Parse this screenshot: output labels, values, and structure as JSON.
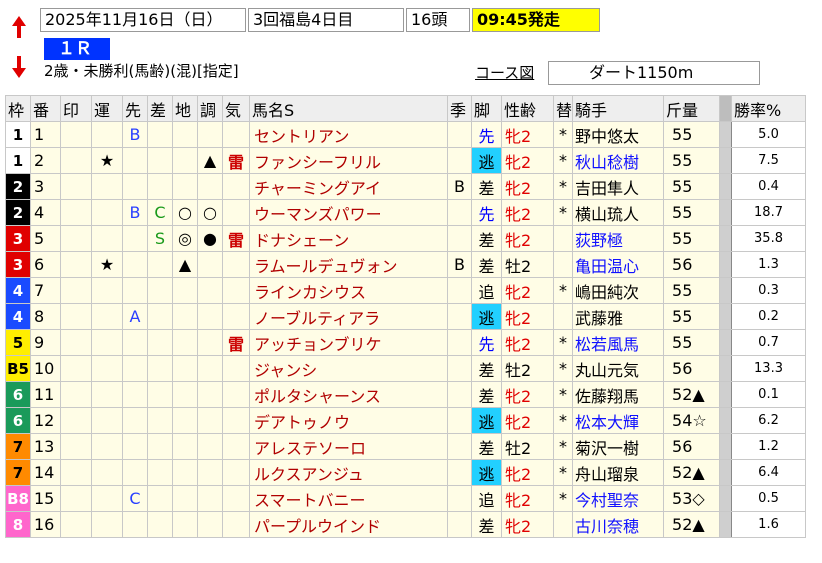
{
  "header": {
    "date": "2025年11月16日（日）",
    "meeting": "3回福島4日目",
    "count": "16頭",
    "start_time": "09:45発走",
    "race_number": "１Ｒ",
    "condition": "2歳・未勝利(馬齢)(混)[指定]",
    "course_label": "コース図",
    "course": "ダート1150m"
  },
  "columns": [
    "枠",
    "番",
    "印",
    "運",
    "先",
    "差",
    "地",
    "調",
    "気",
    "馬名S",
    "季",
    "脚",
    "性齢",
    "替",
    "騎手",
    "斤量",
    "",
    "勝率%"
  ],
  "rows": [
    {
      "waku": "1",
      "wcls": "w1",
      "num": "1",
      "mark": "",
      "un": "",
      "saki": "B",
      "sa": "",
      "chi": "",
      "cho": "",
      "ki": "",
      "name": "セントリアン",
      "season": "",
      "leg": "先",
      "sex": "牝2",
      "kae": "*",
      "jockey": "野中悠太",
      "jblue": false,
      "weight": "55",
      "rate": "5.0"
    },
    {
      "waku": "1",
      "wcls": "w1",
      "num": "2",
      "mark": "",
      "un": "★",
      "saki": "",
      "sa": "",
      "chi": "",
      "cho": "▲",
      "ki": "雷",
      "name": "ファンシーフリル",
      "season": "",
      "leg": "逃",
      "sex": "牝2",
      "kae": "*",
      "jockey": "秋山稔樹",
      "jblue": true,
      "weight": "55",
      "rate": "7.5"
    },
    {
      "waku": "2",
      "wcls": "w2",
      "num": "3",
      "mark": "",
      "un": "",
      "saki": "",
      "sa": "",
      "chi": "",
      "cho": "",
      "ki": "",
      "name": "チャーミングアイ",
      "season": "B",
      "leg": "差",
      "sex": "牝2",
      "kae": "*",
      "jockey": "吉田隼人",
      "jblue": false,
      "weight": "55",
      "rate": "0.4"
    },
    {
      "waku": "2",
      "wcls": "w2",
      "num": "4",
      "mark": "",
      "un": "",
      "saki": "B",
      "sa": "C",
      "chi": "○",
      "cho": "○",
      "ki": "",
      "name": "ウーマンズパワー",
      "season": "",
      "leg": "先",
      "sex": "牝2",
      "kae": "*",
      "jockey": "横山琉人",
      "jblue": false,
      "weight": "55",
      "rate": "18.7"
    },
    {
      "waku": "3",
      "wcls": "w3",
      "num": "5",
      "mark": "",
      "un": "",
      "saki": "",
      "sa": "S",
      "chi": "◎",
      "cho": "●",
      "ki": "雷",
      "name": "ドナシェーン",
      "season": "",
      "leg": "差",
      "sex": "牝2",
      "kae": "",
      "jockey": "荻野極",
      "jblue": true,
      "weight": "55",
      "rate": "35.8"
    },
    {
      "waku": "3",
      "wcls": "w3",
      "num": "6",
      "mark": "",
      "un": "★",
      "saki": "",
      "sa": "",
      "chi": "▲",
      "cho": "",
      "ki": "",
      "name": "ラムールデュヴォン",
      "season": "B",
      "leg": "差",
      "sex": "牡2",
      "kae": "",
      "jockey": "亀田温心",
      "jblue": true,
      "weight": "56",
      "rate": "1.3"
    },
    {
      "waku": "4",
      "wcls": "w4",
      "num": "7",
      "mark": "",
      "un": "",
      "saki": "",
      "sa": "",
      "chi": "",
      "cho": "",
      "ki": "",
      "name": "ラインカシウス",
      "season": "",
      "leg": "追",
      "sex": "牝2",
      "kae": "*",
      "jockey": "嶋田純次",
      "jblue": false,
      "weight": "55",
      "rate": "0.3"
    },
    {
      "waku": "4",
      "wcls": "w4",
      "num": "8",
      "mark": "",
      "un": "",
      "saki": "A",
      "sa": "",
      "chi": "",
      "cho": "",
      "ki": "",
      "name": "ノーブルティアラ",
      "season": "",
      "leg": "逃",
      "sex": "牝2",
      "kae": "",
      "jockey": "武藤雅",
      "jblue": false,
      "weight": "55",
      "rate": "0.2"
    },
    {
      "waku": "5",
      "wcls": "w5",
      "num": "9",
      "mark": "",
      "un": "",
      "saki": "",
      "sa": "",
      "chi": "",
      "cho": "",
      "ki": "雷",
      "name": "アッチョンブリケ",
      "season": "",
      "leg": "先",
      "sex": "牝2",
      "kae": "*",
      "jockey": "松若風馬",
      "jblue": true,
      "weight": "55",
      "rate": "0.7"
    },
    {
      "waku": "B5",
      "wcls": "w5",
      "num": "10",
      "mark": "",
      "un": "",
      "saki": "",
      "sa": "",
      "chi": "",
      "cho": "",
      "ki": "",
      "name": "ジャンシ",
      "season": "",
      "leg": "差",
      "sex": "牡2",
      "kae": "*",
      "jockey": "丸山元気",
      "jblue": false,
      "weight": "56",
      "rate": "13.3"
    },
    {
      "waku": "6",
      "wcls": "w6",
      "num": "11",
      "mark": "",
      "un": "",
      "saki": "",
      "sa": "",
      "chi": "",
      "cho": "",
      "ki": "",
      "name": "ポルタシャーンス",
      "season": "",
      "leg": "差",
      "sex": "牝2",
      "kae": "*",
      "jockey": "佐藤翔馬",
      "jblue": false,
      "weight": "52▲",
      "rate": "0.1"
    },
    {
      "waku": "6",
      "wcls": "w6",
      "num": "12",
      "mark": "",
      "un": "",
      "saki": "",
      "sa": "",
      "chi": "",
      "cho": "",
      "ki": "",
      "name": "デアトゥノウ",
      "season": "",
      "leg": "逃",
      "sex": "牝2",
      "kae": "*",
      "jockey": "松本大輝",
      "jblue": true,
      "weight": "54☆",
      "rate": "6.2"
    },
    {
      "waku": "7",
      "wcls": "w7",
      "num": "13",
      "mark": "",
      "un": "",
      "saki": "",
      "sa": "",
      "chi": "",
      "cho": "",
      "ki": "",
      "name": "アレステソーロ",
      "season": "",
      "leg": "差",
      "sex": "牡2",
      "kae": "*",
      "jockey": "菊沢一樹",
      "jblue": false,
      "weight": "56",
      "rate": "1.2"
    },
    {
      "waku": "7",
      "wcls": "w7",
      "num": "14",
      "mark": "",
      "un": "",
      "saki": "",
      "sa": "",
      "chi": "",
      "cho": "",
      "ki": "",
      "name": "ルクスアンジュ",
      "season": "",
      "leg": "逃",
      "sex": "牝2",
      "kae": "*",
      "jockey": "舟山瑠泉",
      "jblue": false,
      "weight": "52▲",
      "rate": "6.4"
    },
    {
      "waku": "B8",
      "wcls": "w8",
      "num": "15",
      "mark": "",
      "un": "",
      "saki": "C",
      "sa": "",
      "chi": "",
      "cho": "",
      "ki": "",
      "name": "スマートバニー",
      "season": "",
      "leg": "追",
      "sex": "牝2",
      "kae": "*",
      "jockey": "今村聖奈",
      "jblue": true,
      "weight": "53◇",
      "rate": "0.5"
    },
    {
      "waku": "8",
      "wcls": "w8",
      "num": "16",
      "mark": "",
      "un": "",
      "saki": "",
      "sa": "",
      "chi": "",
      "cho": "",
      "ki": "",
      "name": "パープルウインド",
      "season": "",
      "leg": "差",
      "sex": "牝2",
      "kae": "",
      "jockey": "古川奈穂",
      "jblue": true,
      "weight": "52▲",
      "rate": "1.6"
    }
  ]
}
